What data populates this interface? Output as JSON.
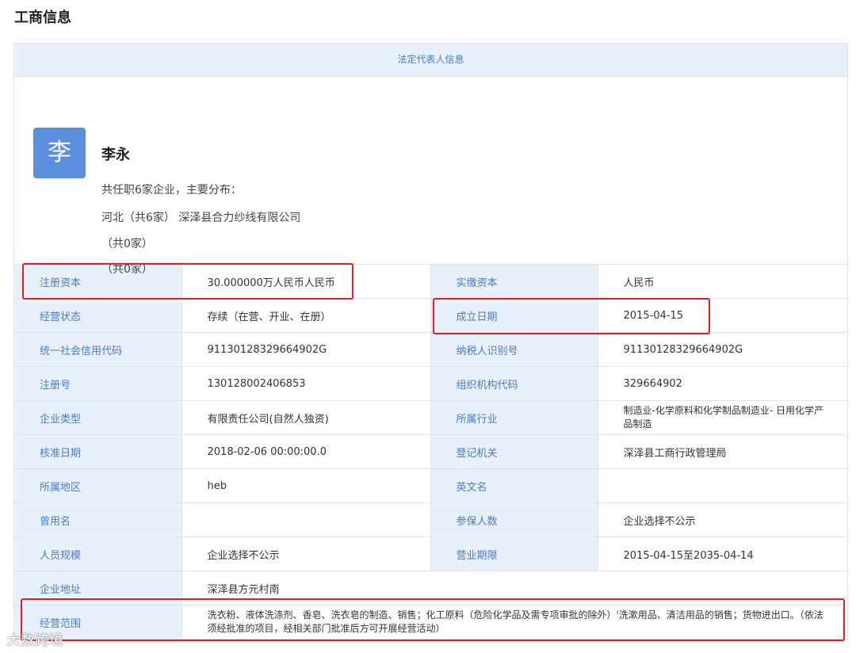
{
  "page_title": "工商信息",
  "legal_rep_header": "法定代表人信息",
  "person": {
    "avatar_char": "李",
    "name": "李永",
    "summary": "共任职6家企业，主要分布：",
    "region_line": "河北（共6家）",
    "company": "深泽县合力纱线有限公司",
    "line3": "（共0家）",
    "line4": "（共0家）"
  },
  "rows": [
    {
      "l1": "注册资本",
      "v1": "30.000000万人民币人民币",
      "l2": "实缴资本",
      "v2": "人民币"
    },
    {
      "l1": "经营状态",
      "v1": "存续（在营、开业、在册）",
      "l2": "成立日期",
      "v2": "2015-04-15"
    },
    {
      "l1": "统一社会信用代码",
      "v1": "91130128329664902G",
      "l2": "纳税人识别号",
      "v2": "91130128329664902G"
    },
    {
      "l1": "注册号",
      "v1": "130128002406853",
      "l2": "组织机构代码",
      "v2": "329664902"
    },
    {
      "l1": "企业类型",
      "v1": "有限责任公司(自然人独资)",
      "l2": "所属行业",
      "v2": "制造业-化学原料和化学制品制造业- 日用化学产品制造"
    },
    {
      "l1": "核准日期",
      "v1": "2018-02-06 00:00:00.0",
      "l2": "登记机关",
      "v2": "深泽县工商行政管理局"
    },
    {
      "l1": "所属地区",
      "v1": "heb",
      "l2": "英文名",
      "v2": ""
    },
    {
      "l1": "曾用名",
      "v1": "",
      "l2": "参保人数",
      "v2": "企业选择不公示"
    },
    {
      "l1": "人员规模",
      "v1": "企业选择不公示",
      "l2": "营业期限",
      "v2": "2015-04-15至2035-04-14"
    }
  ],
  "address": {
    "label": "企业地址",
    "value": "深泽县方元村南"
  },
  "scope": {
    "label": "经营范围",
    "value": "洗衣粉、液体洗涤剂、香皂、洗衣皂的制造、销售；化工原料（危险化学品及需专项审批的除外）'洗漱用品、清洁用品的销售；货物进出口。（依法须经批准的项目，经相关部门批准后方可开展经营活动）"
  },
  "watermark": "大数跨境",
  "colors": {
    "header_bg": "#e8f0fb",
    "label_text": "#4a7bc8",
    "avatar_bg": "#5b8fdd",
    "highlight": "#e02020"
  }
}
